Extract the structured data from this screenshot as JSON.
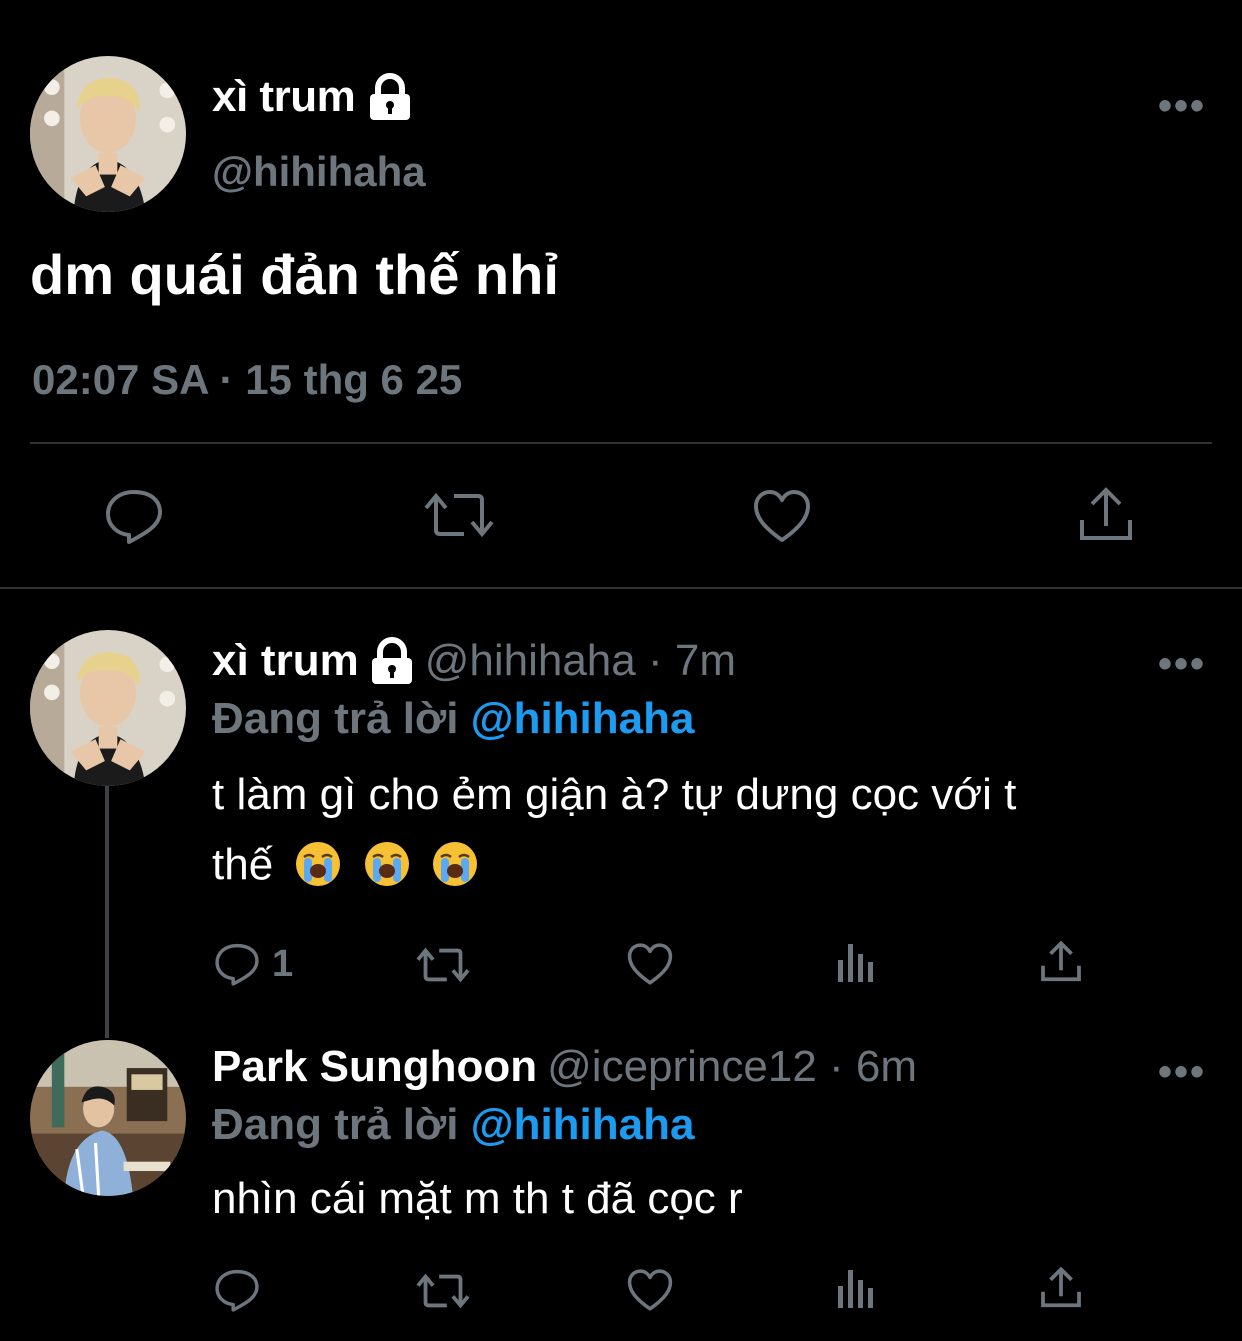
{
  "main_tweet": {
    "display_name": "xì trum",
    "handle": "@hihihaha",
    "text": "dm quái đản thế nhỉ",
    "meta": "02:07 SA · 15 thg 6 25",
    "more_label": "•••",
    "locked": true,
    "actions": [
      "reply-icon",
      "retweet-icon",
      "like-icon",
      "share-icon"
    ]
  },
  "replies": [
    {
      "display_name": "xì trum",
      "handle_time": "@hihihaha · 7m",
      "replying_prefix": "Đang trả lời",
      "replying_to": "@hihihaha",
      "text_line1": "t làm gì cho ẻm giận à? tự dưng cọc với t",
      "text_line2": "thế",
      "emoji": [
        "loudly-crying-face",
        "loudly-crying-face",
        "loudly-crying-face"
      ],
      "reply_count": "1",
      "more_label": "•••",
      "locked": true
    },
    {
      "display_name": "Park Sunghoon",
      "handle_time": "@iceprince12 · 6m",
      "replying_prefix": "Đang trả lời",
      "replying_to": "@hihihaha",
      "text_line1": "nhìn cái mặt m th t đã cọc r",
      "more_label": "•••",
      "locked": false
    }
  ],
  "colors": {
    "background": "#000000",
    "text": "#ffffff",
    "secondary": "#6e767d",
    "accent": "#1d9bf0",
    "divider": "#2f3336"
  }
}
